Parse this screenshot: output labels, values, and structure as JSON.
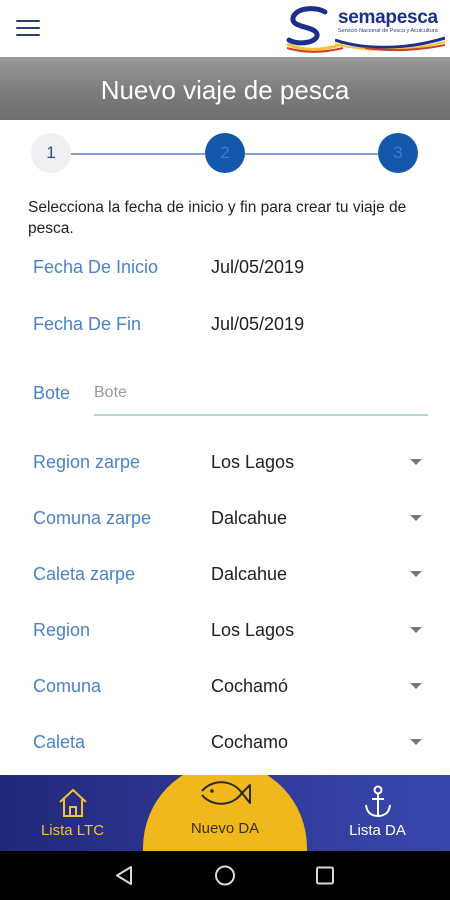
{
  "app": {
    "logo_text": "semapesca",
    "logo_subtitle": "Servicio Nacional de Pesca y Acuicultura",
    "colors": {
      "header_gray": "#7c7c7c",
      "label_blue": "#4b82c9",
      "step_blue": "#1557aa",
      "nav_blue": "#2c3590",
      "nav_accent": "#f0b81d"
    }
  },
  "header": {
    "title": "Nuevo viaje de pesca"
  },
  "stepper": {
    "steps": [
      {
        "label": "1",
        "state": "current"
      },
      {
        "label": "2",
        "state": "pending"
      },
      {
        "label": "3",
        "state": "pending"
      }
    ]
  },
  "form": {
    "instruction": "Selecciona la fecha de inicio y fin para crear tu viaje de pesca.",
    "fecha_inicio": {
      "label": "Fecha De Inicio",
      "value": "Jul/05/2019"
    },
    "fecha_fin": {
      "label": "Fecha De Fin",
      "value": "Jul/05/2019"
    },
    "bote": {
      "label": "Bote",
      "placeholder": "Bote",
      "value": ""
    },
    "region_zarpe": {
      "label": "Region zarpe",
      "value": "Los Lagos"
    },
    "comuna_zarpe": {
      "label": "Comuna zarpe",
      "value": "Dalcahue"
    },
    "caleta_zarpe": {
      "label": "Caleta zarpe",
      "value": "Dalcahue"
    },
    "region": {
      "label": "Region",
      "value": "Los Lagos"
    },
    "comuna": {
      "label": "Comuna",
      "value": "Cochamó"
    },
    "caleta": {
      "label": "Caleta",
      "value": "Cochamo"
    }
  },
  "bottom_nav": {
    "items": [
      {
        "label": "Lista LTC",
        "icon": "home-icon"
      },
      {
        "label": "Nuevo DA",
        "icon": "fish-icon",
        "active": true
      },
      {
        "label": "Lista DA",
        "icon": "anchor-icon"
      }
    ]
  },
  "system_nav": {
    "back": "back-icon",
    "home": "home-circle-icon",
    "recents": "recents-icon"
  }
}
